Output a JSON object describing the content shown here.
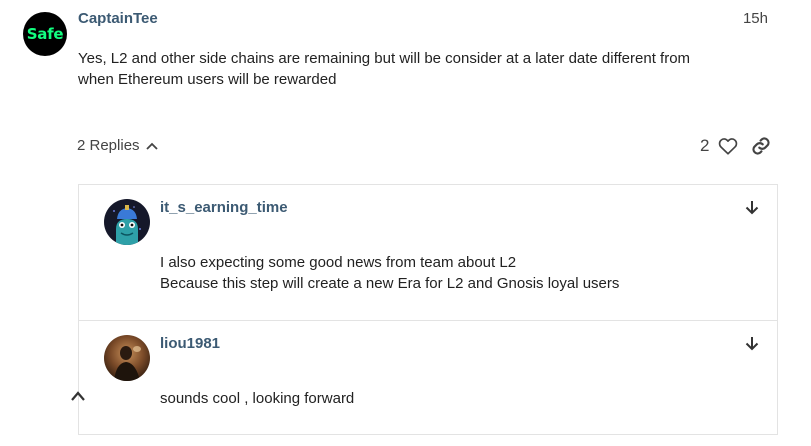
{
  "post": {
    "avatar_text": "Safe",
    "avatar_colors": {
      "background": "#000000",
      "text": "#12ff80"
    },
    "username": "CaptainTee",
    "time": "15h",
    "body_line1": "Yes, L2 and other side chains are remaining but will be consider at a later date different from",
    "body_line2": "when Ethereum users will be rewarded"
  },
  "actions": {
    "replies_label": "2 Replies",
    "replies_icon": "chevron-up-icon",
    "like_count": "2",
    "like_icon": "heart-outline-icon",
    "link_icon": "link-icon"
  },
  "replies": [
    {
      "username": "it_s_earning_time",
      "text_line1": "I also expecting some good news from team about L2",
      "text_line2": "Because this step will create a new Era for L2 and Gnosis loyal users",
      "jump_icon": "arrow-down-icon"
    },
    {
      "username": "liou1981",
      "text_line1": "sounds cool , looking forward",
      "jump_icon": "arrow-down-icon"
    }
  ],
  "collapse_icon": "chevron-up-icon",
  "colors": {
    "username": "#3c5a73",
    "body_text": "#222222",
    "muted_text": "#444444",
    "border": "#e3e3e3"
  }
}
